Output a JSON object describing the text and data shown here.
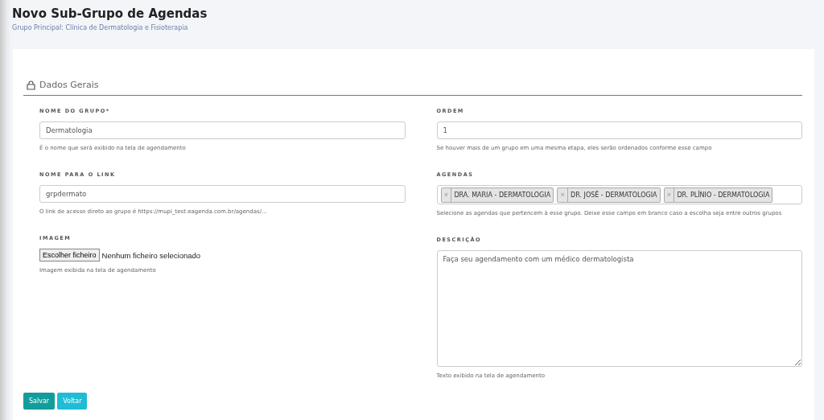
{
  "page": {
    "title": "Novo Sub-Grupo de Agendas",
    "subtitle": "Grupo Principal: Clínica de Dermatologia e Fisioterapia"
  },
  "section": {
    "title": "Dados Gerais"
  },
  "left": [
    {
      "kind": "text",
      "label": "NOME DO GRUPO*",
      "value": "Dermatologia",
      "help": "É o nome que será exibido na tela de agendamento"
    },
    {
      "kind": "text",
      "label": "NOME PARA O LINK",
      "value": "grpdermato",
      "help": "O link de acesso direto ao grupo é https://mupi_test.eagenda.com.br/agendas/..."
    },
    {
      "kind": "file",
      "label": "IMAGEM",
      "button": "Escolher ficheiro",
      "value": "Nenhum ficheiro selecionado",
      "help": "Imagem exibida na tela de agendamento"
    }
  ],
  "right": [
    {
      "kind": "text",
      "label": "ORDEM",
      "value": "1",
      "help": "Se houver mais de um grupo em uma mesma etapa, eles serão ordenados conforme esse campo"
    },
    {
      "kind": "tags",
      "label": "AGENDAS",
      "tags": [
        {
          "remove": "×",
          "text": "DRA. MARIA - DERMATOLOGIA"
        },
        {
          "remove": "×",
          "text": "DR. JOSÉ - DERMATOLOGIA"
        },
        {
          "remove": "×",
          "text": "DR. PLÍNIO - DERMATOLOGIA"
        }
      ],
      "help": "Selecione as agendas que pertencem à esse grupo. Deixe esse campo em branco caso a escolha seja entre outros grupos"
    },
    {
      "kind": "textarea",
      "label": "DESCRIÇÃO",
      "value": "Faça seu agendamento com um médico dermatologista",
      "help": "Texto exibido na tela de agendamento"
    }
  ],
  "buttons": [
    {
      "kind": "primary",
      "label": "Salvar"
    },
    {
      "kind": "secondary",
      "label": "Voltar"
    }
  ]
}
